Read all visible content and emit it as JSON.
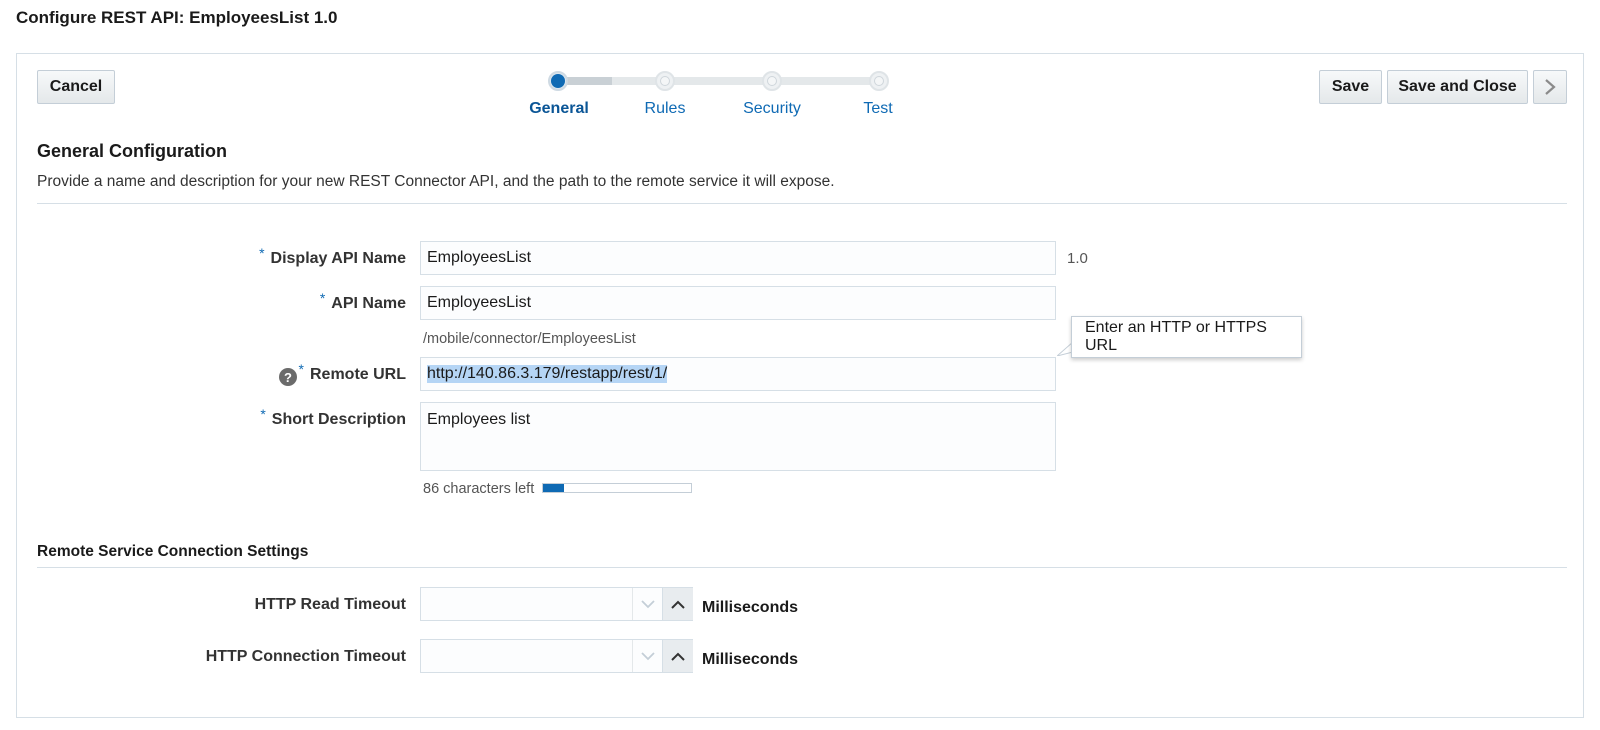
{
  "page": {
    "title": "Configure REST API: EmployeesList 1.0"
  },
  "toolbar": {
    "cancel_label": "Cancel",
    "save_label": "Save",
    "save_close_label": "Save and Close",
    "next_icon": "chevron-right-icon"
  },
  "train": {
    "steps": [
      {
        "label": "General",
        "state": "active"
      },
      {
        "label": "Rules",
        "state": "unvisited"
      },
      {
        "label": "Security",
        "state": "unvisited"
      },
      {
        "label": "Test",
        "state": "unvisited"
      }
    ]
  },
  "general": {
    "title": "General Configuration",
    "description": "Provide a name and description for your new REST Connector API, and the path to the remote service it will expose.",
    "required_marker": "*",
    "display_api_name": {
      "label": "Display API Name",
      "value": "EmployeesList",
      "version": "1.0"
    },
    "api_name": {
      "label": "API Name",
      "value": "EmployeesList",
      "path_hint": "/mobile/connector/EmployeesList"
    },
    "remote_url": {
      "label": "Remote URL",
      "value": "http://140.86.3.179/restapp/rest/1/",
      "help_icon": "?",
      "tooltip": "Enter an HTTP or HTTPS URL"
    },
    "short_description": {
      "label": "Short Description",
      "value": "Employees list",
      "chars_left": "86 characters left",
      "usage_fraction": 0.14
    }
  },
  "remote": {
    "title": "Remote Service Connection Settings",
    "read_timeout": {
      "label": "HTTP Read Timeout",
      "value": "",
      "unit": "Milliseconds"
    },
    "connection_timeout": {
      "label": "HTTP Connection Timeout",
      "value": "",
      "unit": "Milliseconds"
    }
  },
  "colors": {
    "accent": "#0f6ab4",
    "border": "#d6dfe6",
    "selection": "#b5d5f5"
  }
}
